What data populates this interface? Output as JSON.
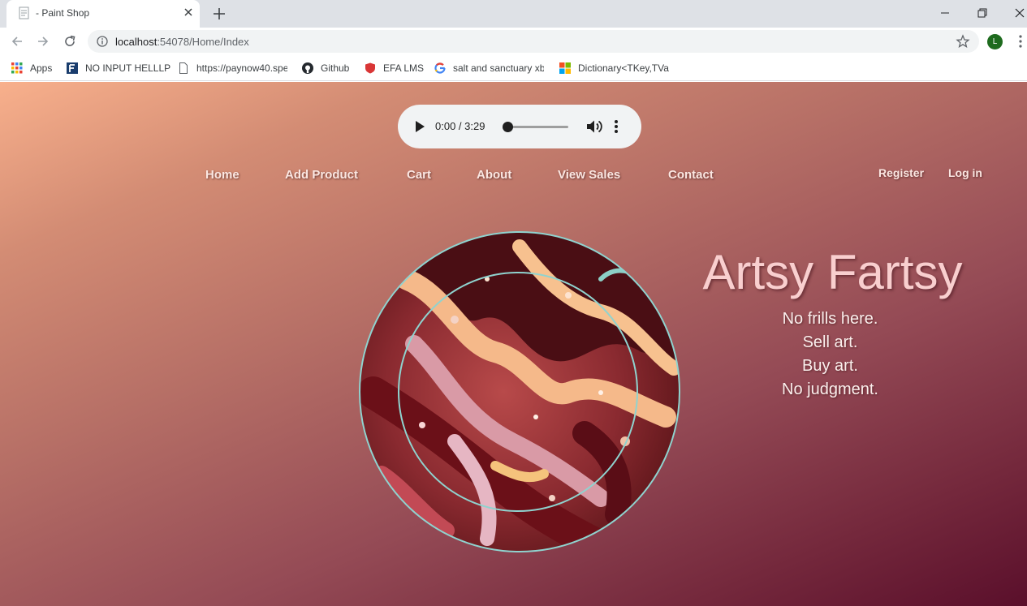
{
  "browser": {
    "tab_title": "- Paint Shop",
    "url_host": "localhost",
    "url_rest": ":54078/Home/Index",
    "profile_initial": "L",
    "bookmarks": [
      {
        "label": "Apps",
        "icon": "apps-grid-icon"
      },
      {
        "label": "NO INPUT HELLLP",
        "icon": "site-favicon-f"
      },
      {
        "label": "https://paynow40.spe",
        "icon": "page-icon"
      },
      {
        "label": "Github",
        "icon": "github-icon"
      },
      {
        "label": "EFA LMS",
        "icon": "shield-icon"
      },
      {
        "label": "salt and sanctuary xb",
        "icon": "google-icon"
      },
      {
        "label": "Dictionary<TKey,TVal",
        "icon": "microsoft-icon"
      }
    ]
  },
  "audio": {
    "time": "0:00 / 3:29",
    "progress": 0
  },
  "nav": {
    "home": "Home",
    "add_product": "Add Product",
    "cart": "Cart",
    "about": "About",
    "view_sales": "View Sales",
    "contact": "Contact",
    "register": "Register",
    "login": "Log in"
  },
  "hero": {
    "title": "Artsy Fartsy",
    "taglines": [
      "No frills here.",
      "Sell art.",
      "Buy art.",
      "No judgment."
    ]
  },
  "colors": {
    "page_gradient_start": "#f8b08c",
    "page_gradient_end": "#5a0f2b",
    "ring_color": "#8fd3cf",
    "title_color": "#f9cfcf"
  }
}
